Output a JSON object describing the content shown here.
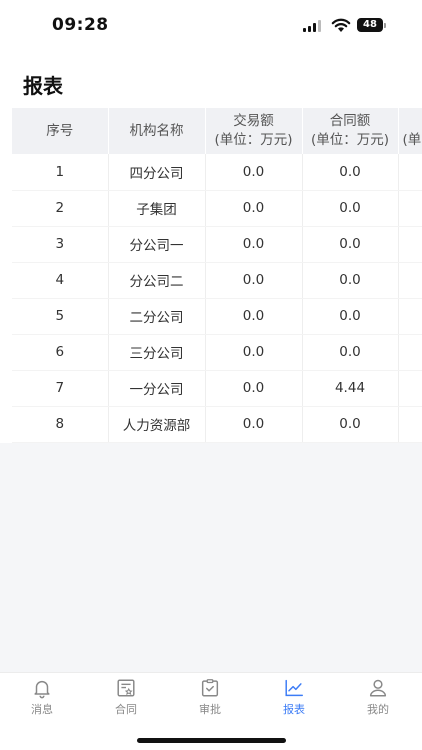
{
  "status": {
    "time": "09:28",
    "battery": "48"
  },
  "page": {
    "title": "报表"
  },
  "table": {
    "headers": [
      {
        "line1": "序号",
        "line2": ""
      },
      {
        "line1": "机构名称",
        "line2": ""
      },
      {
        "line1": "交易额",
        "line2": "(单位：万元)"
      },
      {
        "line1": "合同额",
        "line2": "(单位：万元)"
      },
      {
        "line1": "",
        "line2": "(单"
      }
    ],
    "rows": [
      {
        "no": "1",
        "org": "四分公司",
        "trade": "0.0",
        "contract": "0.0"
      },
      {
        "no": "2",
        "org": "子集团",
        "trade": "0.0",
        "contract": "0.0"
      },
      {
        "no": "3",
        "org": "分公司一",
        "trade": "0.0",
        "contract": "0.0"
      },
      {
        "no": "4",
        "org": "分公司二",
        "trade": "0.0",
        "contract": "0.0"
      },
      {
        "no": "5",
        "org": "二分公司",
        "trade": "0.0",
        "contract": "0.0"
      },
      {
        "no": "6",
        "org": "三分公司",
        "trade": "0.0",
        "contract": "0.0"
      },
      {
        "no": "7",
        "org": "一分公司",
        "trade": "0.0",
        "contract": "4.44"
      },
      {
        "no": "8",
        "org": "人力资源部",
        "trade": "0.0",
        "contract": "0.0"
      }
    ]
  },
  "tabs": [
    {
      "label": "消息",
      "icon": "bell-icon"
    },
    {
      "label": "合同",
      "icon": "contract-icon"
    },
    {
      "label": "审批",
      "icon": "approval-icon"
    },
    {
      "label": "报表",
      "icon": "chart-icon"
    },
    {
      "label": "我的",
      "icon": "user-icon"
    }
  ],
  "colors": {
    "accent": "#3c7cf6",
    "inactive": "#888888",
    "header_bg": "#f0f1f4"
  }
}
